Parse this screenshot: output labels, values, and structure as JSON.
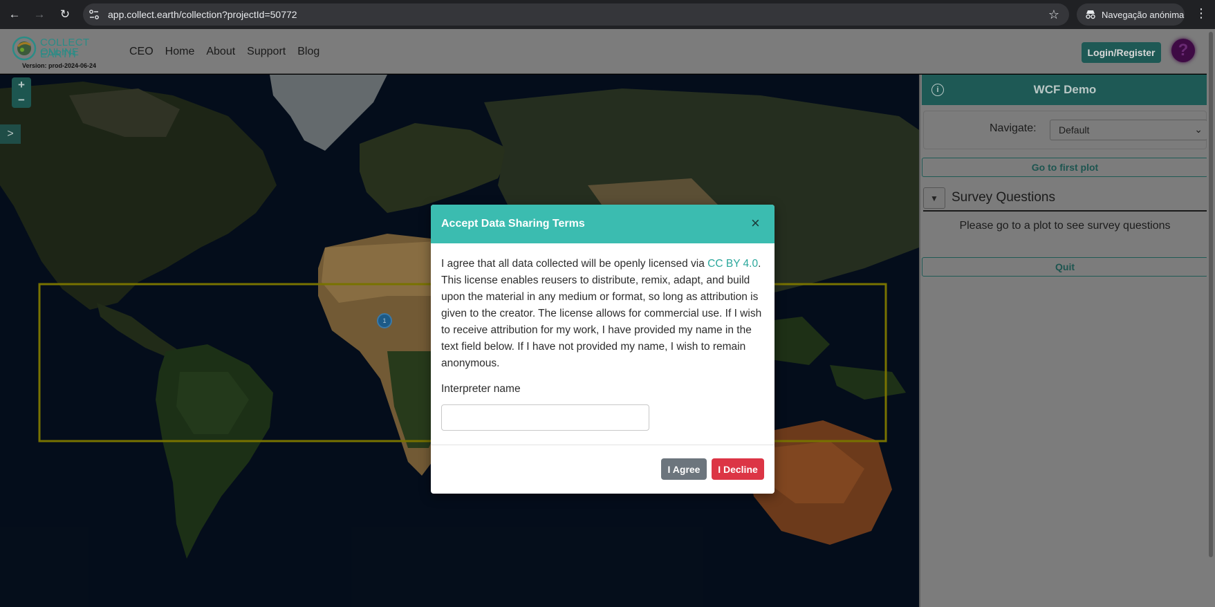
{
  "browser": {
    "url": "app.collect.earth/collection?projectId=50772",
    "incognito_label": "Navegação anónima"
  },
  "header": {
    "logo_line1": "COLLECT EARTH",
    "logo_line2": "ONLINE",
    "version": "Version: prod-2024-06-24",
    "nav": [
      "CEO",
      "Home",
      "About",
      "Support",
      "Blog"
    ],
    "login_label": "Login/Register",
    "help_label": "?"
  },
  "map": {
    "zoom_in": "+",
    "zoom_out": "−",
    "plot_marker": "1"
  },
  "panel": {
    "title": "WCF Demo",
    "navigate_label": "Navigate:",
    "navigate_value": "Default",
    "first_plot_label": "Go to first plot",
    "survey_title": "Survey Questions",
    "survey_empty": "Please go to a plot to see survey questions",
    "quit_label": "Quit"
  },
  "modal": {
    "title": "Accept Data Sharing Terms",
    "close": "×",
    "text_before_link": "I agree that all data collected will be openly licensed via ",
    "link_text": "CC BY 4.0",
    "text_after_link": ". This license enables reusers to distribute, remix, adapt, and build upon the material in any medium or format, so long as attribution is given to the creator. The license allows for commercial use. If I wish to receive attribution for my work, I have provided my name in the text field below. If I have not provided my name, I wish to remain anonymous.",
    "name_label": "Interpreter name",
    "name_value": "",
    "agree_label": "I Agree",
    "decline_label": "I Decline"
  },
  "colors": {
    "teal": "#3bbcb0",
    "decline": "#dc3545",
    "agree": "#6c757d",
    "plot_boundary": "#b8b000"
  }
}
